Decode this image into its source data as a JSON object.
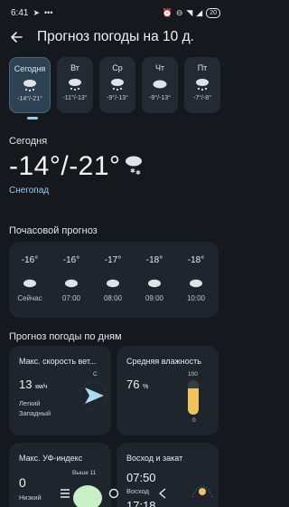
{
  "status_bar": {
    "time": "6:41",
    "battery": "20"
  },
  "header": {
    "title": "Прогноз погоды на 10 д."
  },
  "days": [
    {
      "name": "Сегодня",
      "temp": "-14°/-21°",
      "icon": "snow-cloud-icon",
      "selected": true
    },
    {
      "name": "Вт",
      "temp": "-11°/-13°",
      "icon": "snow-cloud-icon"
    },
    {
      "name": "Ср",
      "temp": "-9°/-13°",
      "icon": "snow-cloud-icon"
    },
    {
      "name": "Чт",
      "temp": "-9°/-13°",
      "icon": "cloud-icon"
    },
    {
      "name": "Пт",
      "temp": "-7°/-8°",
      "icon": "snow-cloud-icon"
    }
  ],
  "today": {
    "label": "Сегодня",
    "temp": "-14°/-21°",
    "condition": "Снегопад",
    "icon": "snow-cloud-icon"
  },
  "hourly": {
    "title": "Почасовой прогноз",
    "items": [
      {
        "temp": "-16°",
        "time": "Сейчас",
        "icon": "cloud-icon"
      },
      {
        "temp": "-16°",
        "time": "07:00",
        "icon": "cloud-icon"
      },
      {
        "temp": "-17°",
        "time": "08:00",
        "icon": "cloud-icon"
      },
      {
        "temp": "-18°",
        "time": "09:00",
        "icon": "cloud-icon"
      },
      {
        "temp": "-18°",
        "time": "10:00",
        "icon": "cloud-icon"
      }
    ]
  },
  "details": {
    "title": "Прогноз погоды по дням",
    "wind": {
      "title": "Макс. скорость вет...",
      "value": "13",
      "unit": "км/ч",
      "strength": "Легкий",
      "direction": "Западный",
      "compass_label": "С"
    },
    "humidity": {
      "title": "Средняя влажность",
      "value": "76",
      "unit": "%",
      "scale_max": "100",
      "scale_min": "0",
      "level": 0.76
    },
    "uv": {
      "title": "Макс. УФ-индекс",
      "value": "0",
      "desc": "Низкий",
      "max_label": "Выше 11"
    },
    "sun": {
      "title": "Восход и закат",
      "sunrise": "07:50",
      "sunrise_label": "Восход",
      "sunset": "17:18"
    }
  },
  "colors": {
    "background": "#15191e",
    "card": "#1e252d",
    "accent": "#8fcdf0",
    "humidity_fill": "#f2c35b",
    "uv_fill": "#c9f0c4"
  }
}
